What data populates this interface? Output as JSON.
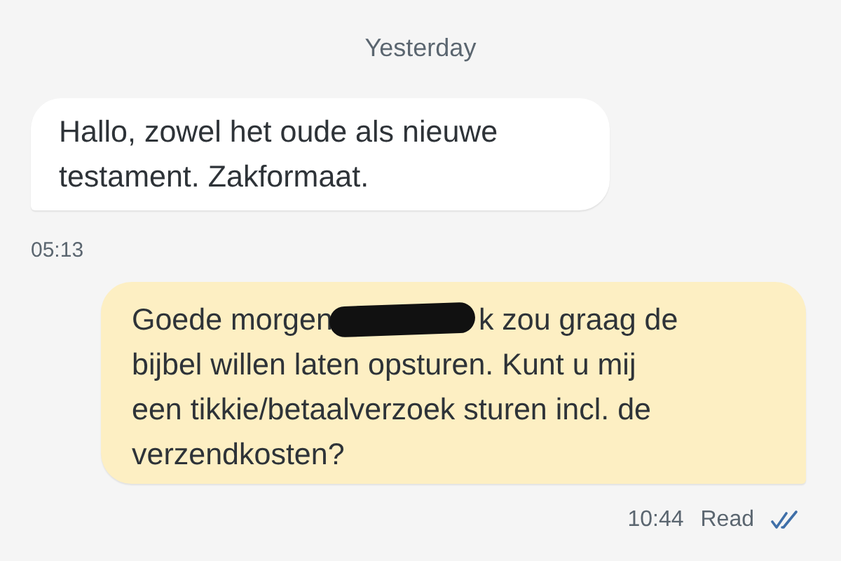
{
  "date_divider": "Yesterday",
  "messages": [
    {
      "kind": "incoming",
      "lines": [
        [
          {
            "kind": "text",
            "text": "Hallo, zowel het oude als nieuwe testament. Zakformaat."
          }
        ]
      ],
      "time": "05:13"
    },
    {
      "kind": "outgoing",
      "lines": [
        [
          {
            "kind": "text",
            "text": "Goede morgen"
          },
          {
            "kind": "redaction"
          },
          {
            "kind": "text",
            "text": "k zou graag de"
          }
        ],
        [
          {
            "kind": "text",
            "text": "bijbel willen laten opsturen. Kunt u mij een tikkie/betaalverzoek sturen incl. de verzendkosten?"
          }
        ]
      ],
      "time": "10:44",
      "status": "Read"
    }
  ]
}
